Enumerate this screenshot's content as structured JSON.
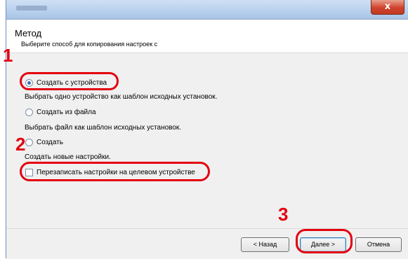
{
  "window": {
    "close_glyph": "x"
  },
  "header": {
    "title": "Метод",
    "subtitle": "Выберите способ для копирования настроек с"
  },
  "options": {
    "from_device": {
      "label": "Создать с устройства",
      "checked": true,
      "description": "Выбрать одно устройство как шаблон исходных установок."
    },
    "from_file": {
      "label": "Создать из файла",
      "checked": false,
      "description": "Выбрать файл как шаблон исходных установок."
    },
    "create": {
      "label": "Создать",
      "checked": false,
      "description": "Создать новые настройки."
    },
    "overwrite": {
      "label": "Перезаписать настройки на целевом устройстве",
      "checked": false
    }
  },
  "steps": {
    "one": "1",
    "two": "2",
    "three": "3"
  },
  "footer": {
    "back_label": "< Назад",
    "next_label": "Далее >",
    "cancel_label": "Отмена"
  },
  "colors": {
    "highlight": "#e3000f",
    "accent": "#3a6fb6"
  }
}
